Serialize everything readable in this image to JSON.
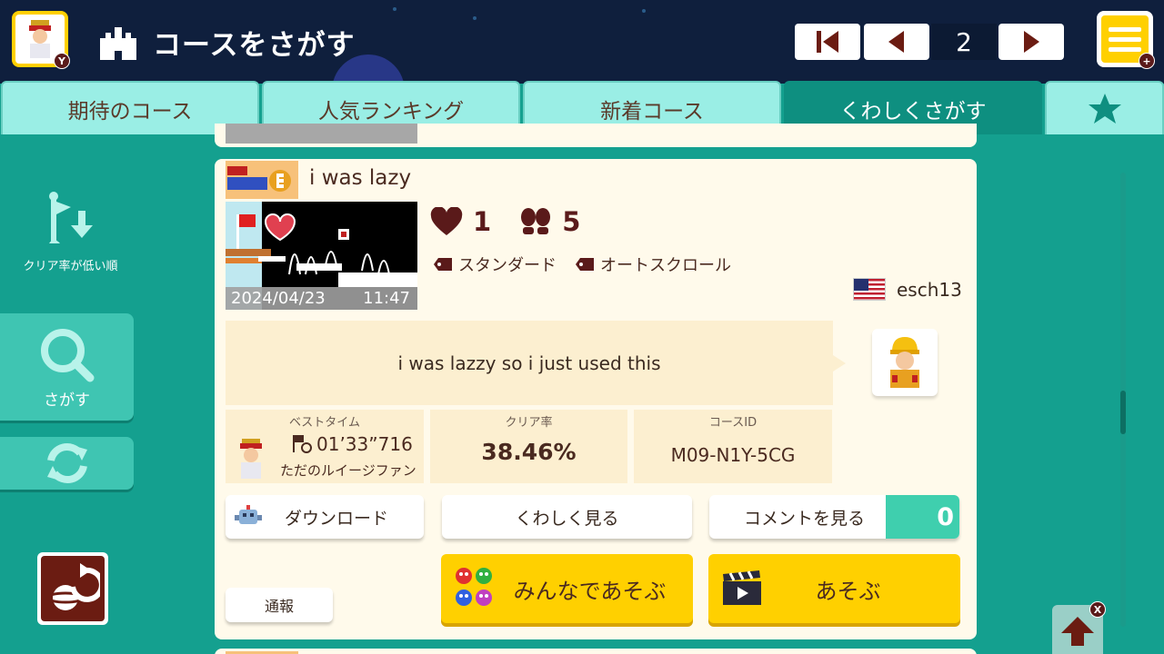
{
  "header": {
    "avatar_badge": "Y",
    "title": "コースをさがす",
    "page_number": "2",
    "menu_badge": "+"
  },
  "tabs": [
    {
      "label": "期待のコース",
      "active": false
    },
    {
      "label": "人気ランキング",
      "active": false
    },
    {
      "label": "新着コース",
      "active": false
    },
    {
      "label": "くわしくさがす",
      "active": true
    }
  ],
  "sidebar": {
    "sort_label": "クリア率が低い順",
    "search_label": "さがす"
  },
  "course": {
    "name": "i was lazy",
    "game_style": "SUPER MARIO BROS. 3",
    "upload_date": "2024/04/23",
    "upload_time": "11:47",
    "likes": "1",
    "plays": "5",
    "tags": [
      "スタンダード",
      "オートスクロール"
    ],
    "maker_name": "esch13",
    "description": "i was lazzy so i just used this",
    "best_time_caption": "ベストタイム",
    "best_time": "01’33”716",
    "best_time_holder": "ただのルイージファン",
    "clear_rate_caption": "クリア率",
    "clear_rate": "38.46%",
    "course_id_caption": "コースID",
    "course_id": "M09-N1Y-5CG"
  },
  "buttons": {
    "download": "ダウンロード",
    "details": "くわしく見る",
    "comments": "コメントを見る",
    "comment_count": "0",
    "report": "通報",
    "multiplayer": "みんなであそぶ",
    "play": "あそぶ"
  },
  "top_button_badge": "X",
  "colors": {
    "accent_yellow": "#ffd000",
    "teal_bg": "#14a08f",
    "tab_light": "#9aeee5",
    "tab_active": "#0e8f80",
    "card_bg": "#fffaeb",
    "header_bg": "#0f1f3d"
  }
}
